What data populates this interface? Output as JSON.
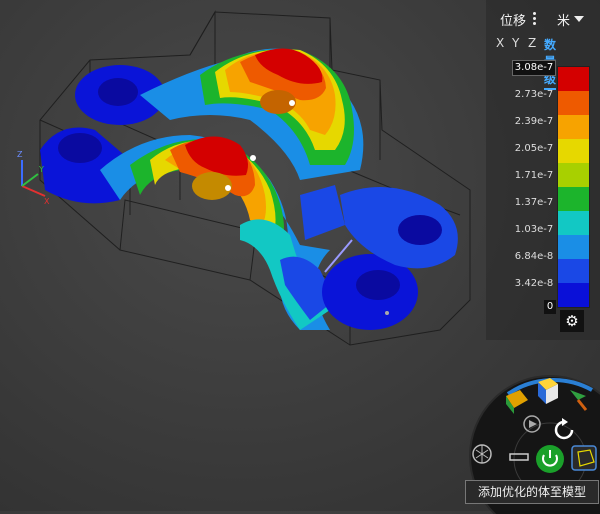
{
  "panel": {
    "quantity_label": "位移",
    "unit": "米",
    "tabs": [
      "X",
      "Y",
      "Z",
      "数量级"
    ],
    "active_tab": "数量级"
  },
  "legend": {
    "max_label": "3.08e-7",
    "ticks": [
      "2.73e-7",
      "2.39e-7",
      "2.05e-7",
      "1.71e-7",
      "1.37e-7",
      "1.03e-7",
      "6.84e-8",
      "3.42e-8"
    ],
    "min_label": "0",
    "colors": [
      "#d40000",
      "#ee5a00",
      "#f7a300",
      "#e6d800",
      "#a8d000",
      "#1cb42c",
      "#12c8c4",
      "#1a8ee6",
      "#1a48e6",
      "#0a10d8"
    ]
  },
  "axes_triad": {
    "x": "X",
    "y": "Y",
    "z": "Z"
  },
  "tooltip": "添加优化的体至模型",
  "icons": {
    "menu": "kebab-icon",
    "settings": "gear-icon",
    "power": "power-icon",
    "undo": "undo-icon",
    "play": "play-icon"
  }
}
